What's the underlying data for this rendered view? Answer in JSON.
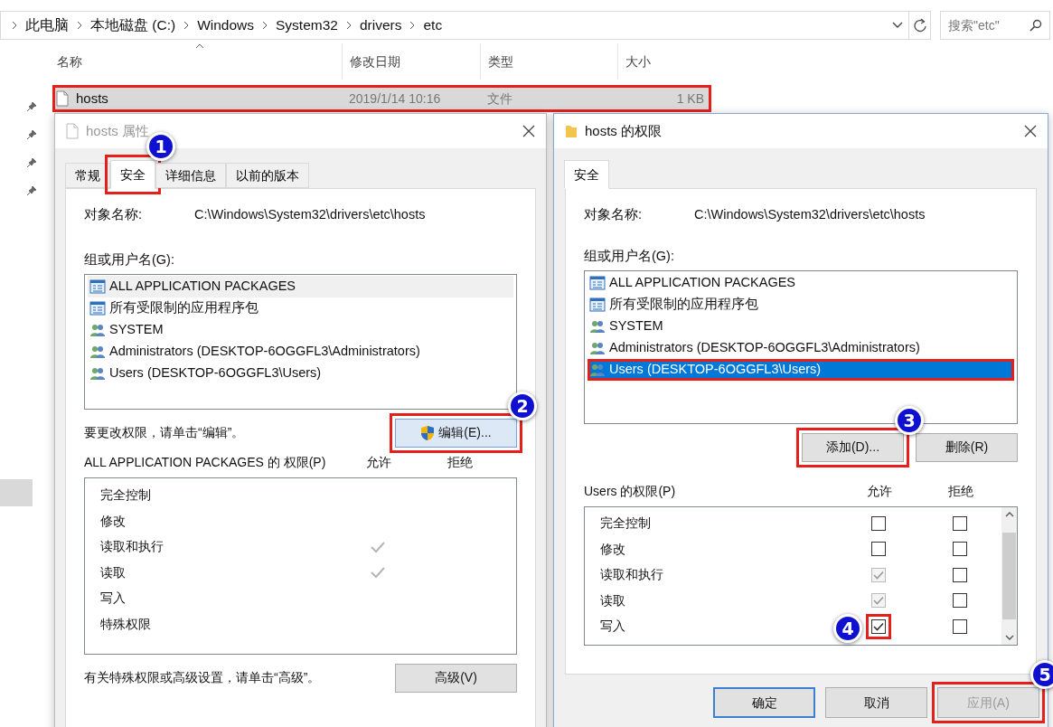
{
  "explorer": {
    "breadcrumb": [
      "此电脑",
      "本地磁盘 (C:)",
      "Windows",
      "System32",
      "drivers",
      "etc"
    ],
    "search": {
      "placeholder": "搜索\"etc\""
    },
    "columns": [
      "名称",
      "修改日期",
      "类型",
      "大小"
    ],
    "rows": [
      {
        "name": "hosts",
        "modified": "2019/1/14 10:16",
        "type": "文件",
        "size": "1 KB",
        "selected": true,
        "outlined": true
      }
    ]
  },
  "properties_dialog": {
    "title": "hosts 属性",
    "active": false,
    "tabs": [
      {
        "label": "常规",
        "selected": false
      },
      {
        "label": "安全",
        "selected": true,
        "step": "1"
      },
      {
        "label": "详细信息",
        "selected": false
      },
      {
        "label": "以前的版本",
        "selected": false
      }
    ],
    "object_label": "对象名称:",
    "object_value": "C:\\Windows\\System32\\drivers\\etc\\hosts",
    "groups_label": "组或用户名(G):",
    "groups": [
      {
        "name": "ALL APPLICATION PACKAGES",
        "kind": "package",
        "selected": false,
        "focused": true
      },
      {
        "name": "所有受限制的应用程序包",
        "kind": "package",
        "selected": false,
        "focused": false
      },
      {
        "name": "SYSTEM",
        "kind": "user",
        "selected": false,
        "focused": false
      },
      {
        "name": "Administrators (DESKTOP-6OGGFL3\\Administrators)",
        "kind": "user",
        "selected": false,
        "focused": false
      },
      {
        "name": "Users (DESKTOP-6OGGFL3\\Users)",
        "kind": "user",
        "selected": false,
        "focused": false
      }
    ],
    "hint": "要更改权限，请单击“编辑”。",
    "edit_button": {
      "label": "编辑(E)...",
      "step": "2"
    },
    "permissions_label": "ALL APPLICATION PACKAGES 的 权限(P)",
    "allow_header": "允许",
    "deny_header": "拒绝",
    "permissions": [
      {
        "name": "完全控制",
        "allow": false,
        "deny": false
      },
      {
        "name": "修改",
        "allow": false,
        "deny": false
      },
      {
        "name": "读取和执行",
        "allow": true,
        "deny": false
      },
      {
        "name": "读取",
        "allow": true,
        "deny": false
      },
      {
        "name": "写入",
        "allow": false,
        "deny": false
      },
      {
        "name": "特殊权限",
        "allow": false,
        "deny": false
      }
    ],
    "advanced_hint": "有关特殊权限或高级设置，请单击“高级”。",
    "advanced_button": "高级(V)"
  },
  "permissions_dialog": {
    "title": "hosts 的权限",
    "active": true,
    "tabs": [
      {
        "label": "安全",
        "selected": true
      }
    ],
    "object_label": "对象名称:",
    "object_value": "C:\\Windows\\System32\\drivers\\etc\\hosts",
    "groups_label": "组或用户名(G):",
    "groups": [
      {
        "name": "ALL APPLICATION PACKAGES",
        "kind": "package",
        "selected": false
      },
      {
        "name": "所有受限制的应用程序包",
        "kind": "package",
        "selected": false
      },
      {
        "name": "SYSTEM",
        "kind": "user",
        "selected": false
      },
      {
        "name": "Administrators (DESKTOP-6OGGFL3\\Administrators)",
        "kind": "user",
        "selected": false
      },
      {
        "name": "Users (DESKTOP-6OGGFL3\\Users)",
        "kind": "user",
        "selected": true,
        "outlined": true
      }
    ],
    "add_button": {
      "label": "添加(D)...",
      "step": "3"
    },
    "remove_button": {
      "label": "删除(R)"
    },
    "permissions_label": "Users 的权限(P)",
    "allow_header": "允许",
    "deny_header": "拒绝",
    "permissions": [
      {
        "name": "完全控制",
        "allow": false,
        "allow_disabled": false,
        "deny": false
      },
      {
        "name": "修改",
        "allow": false,
        "allow_disabled": false,
        "deny": false
      },
      {
        "name": "读取和执行",
        "allow": true,
        "allow_disabled": true,
        "deny": false
      },
      {
        "name": "读取",
        "allow": true,
        "allow_disabled": true,
        "deny": false
      },
      {
        "name": "写入",
        "allow": true,
        "allow_disabled": false,
        "deny": false,
        "step": "4"
      }
    ],
    "buttons": [
      {
        "label": "确定",
        "kind": "default",
        "disabled": false
      },
      {
        "label": "取消",
        "kind": "normal",
        "disabled": false
      },
      {
        "label": "应用(A)",
        "kind": "normal",
        "disabled": true,
        "step": "5"
      }
    ]
  }
}
